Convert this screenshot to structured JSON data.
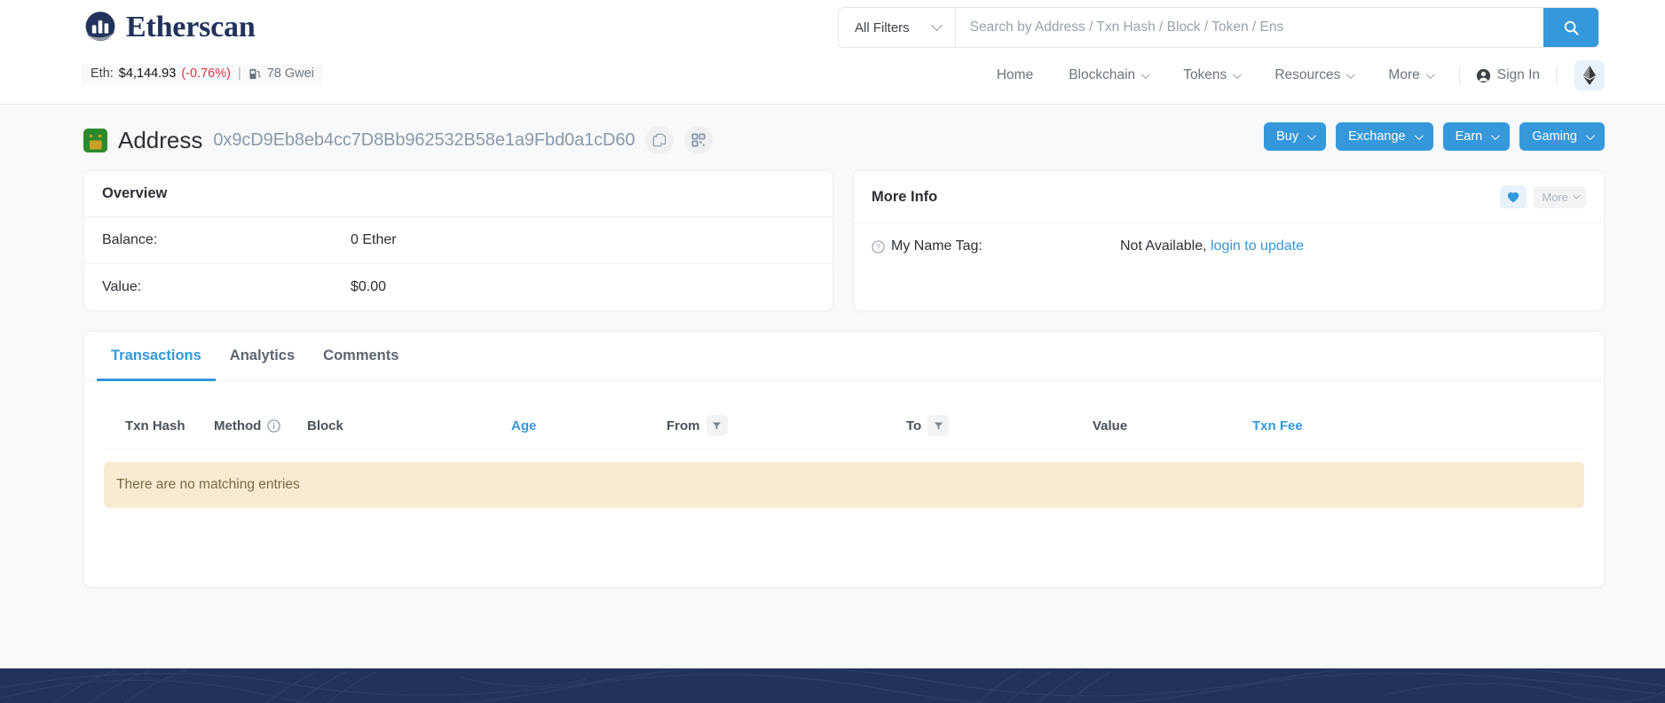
{
  "header": {
    "brand": "Etherscan",
    "price": {
      "eth_label": "Eth:",
      "eth_price": "$4,144.93",
      "eth_change": "(-0.76%)",
      "separator": "|",
      "gas": "78 Gwei",
      "gas_icon": "gas-pump-icon"
    },
    "search": {
      "filter_label": "All Filters",
      "placeholder": "Search by Address / Txn Hash / Block / Token / Ens",
      "value": "",
      "search_icon": "search-icon"
    },
    "nav": [
      {
        "label": "Home",
        "has_dropdown": false
      },
      {
        "label": "Blockchain",
        "has_dropdown": true
      },
      {
        "label": "Tokens",
        "has_dropdown": true
      },
      {
        "label": "Resources",
        "has_dropdown": true
      },
      {
        "label": "More",
        "has_dropdown": true
      }
    ],
    "sign_in": "Sign In",
    "sign_in_icon": "user-circle-icon",
    "network_icon": "ethereum-diamond-icon"
  },
  "address_page": {
    "title": "Address",
    "hash": "0x9cD9Eb8eb4cc7D8Bb962532B58e1a9Fbd0a1cD60",
    "copy_icon": "copy-icon",
    "qr_icon": "qr-code-icon",
    "identicon": "address-identicon",
    "actions": [
      {
        "label": "Buy"
      },
      {
        "label": "Exchange"
      },
      {
        "label": "Earn"
      },
      {
        "label": "Gaming"
      }
    ]
  },
  "overview": {
    "title": "Overview",
    "rows": [
      {
        "key": "Balance:",
        "value": "0 Ether"
      },
      {
        "key": "Value:",
        "value": "$0.00"
      }
    ]
  },
  "more_info": {
    "title": "More Info",
    "favorite_icon": "heart-icon",
    "more_label": "More",
    "name_tag": {
      "help_icon": "question-circle-icon",
      "key": "My Name Tag:",
      "value": "Not Available,",
      "link": "login to update"
    }
  },
  "tabs": [
    {
      "label": "Transactions",
      "active": true
    },
    {
      "label": "Analytics",
      "active": false
    },
    {
      "label": "Comments",
      "active": false
    }
  ],
  "table": {
    "columns": [
      {
        "label": "Txn Hash",
        "is_link": false,
        "icon": null
      },
      {
        "label": "Method",
        "is_link": false,
        "icon": "info-icon"
      },
      {
        "label": "Block",
        "is_link": false,
        "icon": null
      },
      {
        "label": "Age",
        "is_link": true,
        "icon": null
      },
      {
        "label": "From",
        "is_link": false,
        "icon": "filter-icon"
      },
      {
        "label": "To",
        "is_link": false,
        "icon": "filter-icon"
      },
      {
        "label": "Value",
        "is_link": false,
        "icon": null
      },
      {
        "label": "Txn Fee",
        "is_link": true,
        "icon": null
      }
    ],
    "empty_message": "There are no matching entries",
    "rows": []
  },
  "colors": {
    "accent_blue": "#3498db",
    "brand_navy": "#21325b",
    "footer_navy": "#23325a",
    "empty_bg": "#f7ecd2",
    "negative_red": "#dc3545",
    "page_bg": "#f8f9fa"
  }
}
